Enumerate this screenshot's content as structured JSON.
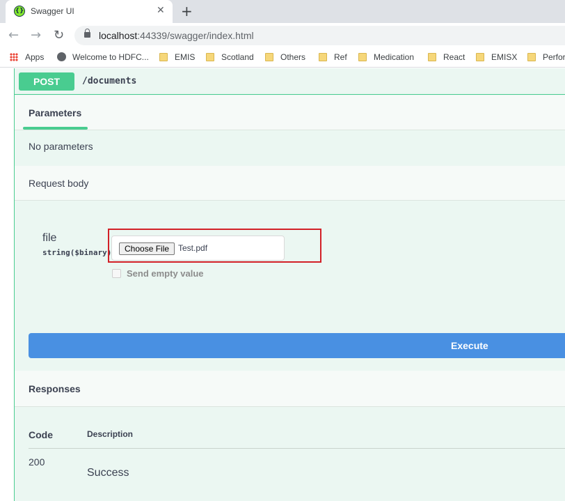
{
  "browser": {
    "tab_title": "Swagger UI",
    "tab_close": "✕",
    "new_tab": "+",
    "url_host": "localhost",
    "url_rest": ":44339/swagger/index.html",
    "bookmarks": [
      "Apps",
      "Welcome to HDFC...",
      "EMIS",
      "Scotland",
      "Others",
      "Ref",
      "Medication",
      "React",
      "EMISX",
      "Perfor"
    ]
  },
  "operation": {
    "method": "POST",
    "path": "/documents"
  },
  "parameters": {
    "tab_label": "Parameters",
    "empty_text": "No parameters"
  },
  "request_body": {
    "title": "Request body",
    "field_name": "file",
    "field_type": "string($binary)",
    "choose_label": "Choose File",
    "file_name": "Test.pdf",
    "empty_value_label": "Send empty value"
  },
  "execute_label": "Execute",
  "responses": {
    "title": "Responses",
    "col_code": "Code",
    "col_description": "Description",
    "rows": [
      {
        "code": "200",
        "description": "Success"
      }
    ]
  },
  "colors": {
    "post_green": "#49cc90",
    "execute_blue": "#4990e2",
    "highlight_red": "#d22027"
  }
}
